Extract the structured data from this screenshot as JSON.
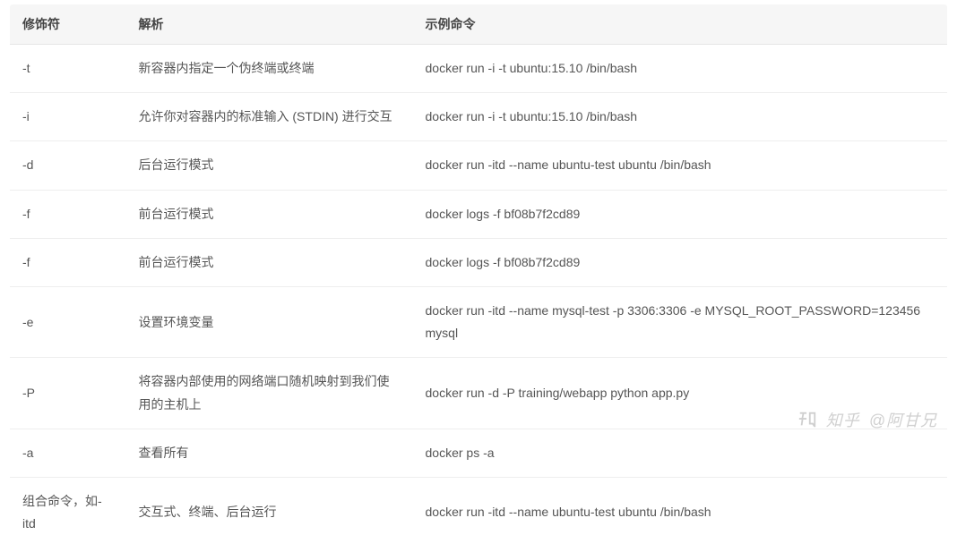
{
  "table": {
    "headers": [
      "修饰符",
      "解析",
      "示例命令"
    ],
    "rows": [
      {
        "mod": "-t",
        "desc": "新容器内指定一个伪终端或终端",
        "cmd": "docker run -i -t ubuntu:15.10 /bin/bash"
      },
      {
        "mod": "-i",
        "desc": "允许你对容器内的标准输入 (STDIN) 进行交互",
        "cmd": "docker run -i -t ubuntu:15.10 /bin/bash"
      },
      {
        "mod": "-d",
        "desc": "后台运行模式",
        "cmd": "docker run -itd --name ubuntu-test ubuntu /bin/bash"
      },
      {
        "mod": "-f",
        "desc": "前台运行模式",
        "cmd": "docker logs -f bf08b7f2cd89"
      },
      {
        "mod": "-f",
        "desc": "前台运行模式",
        "cmd": "docker logs -f bf08b7f2cd89"
      },
      {
        "mod": "-e",
        "desc": "设置环境变量",
        "cmd": "docker run -itd --name mysql-test -p 3306:3306 -e MYSQL_ROOT_PASSWORD=123456 mysql"
      },
      {
        "mod": "-P",
        "desc": "将容器内部使用的网络端口随机映射到我们使用的主机上",
        "cmd": "docker run -d -P training/webapp python app.py"
      },
      {
        "mod": "-a",
        "desc": "查看所有",
        "cmd": "docker ps -a"
      },
      {
        "mod": "组合命令，如-itd",
        "desc": "交互式、终端、后台运行",
        "cmd": "docker run -itd --name ubuntu-test ubuntu /bin/bash"
      }
    ]
  },
  "watermark": {
    "brand": "知乎",
    "author": "@阿甘兄"
  }
}
